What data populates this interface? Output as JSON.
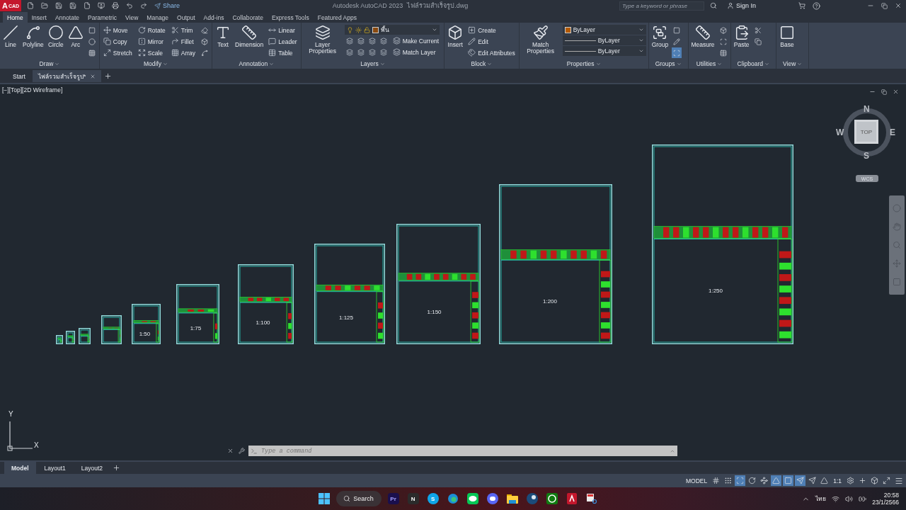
{
  "title_bar": {
    "logo": {
      "letter": "A",
      "sub": "CAD"
    },
    "share": "Share",
    "title": "Autodesk AutoCAD 2023",
    "file": "ไฟล์รวมสำเร็จรูป.dwg",
    "search": {
      "placeholder": "Type a keyword or phrase"
    },
    "sign_in": "Sign In"
  },
  "ribbon_tabs": [
    {
      "label": "Home",
      "selected": true
    },
    {
      "label": "Insert",
      "selected": false
    },
    {
      "label": "Annotate",
      "selected": false
    },
    {
      "label": "Parametric",
      "selected": false
    },
    {
      "label": "View",
      "selected": false
    },
    {
      "label": "Manage",
      "selected": false
    },
    {
      "label": "Output",
      "selected": false
    },
    {
      "label": "Add-ins",
      "selected": false
    },
    {
      "label": "Collaborate",
      "selected": false
    },
    {
      "label": "Express Tools",
      "selected": false
    },
    {
      "label": "Featured Apps",
      "selected": false
    }
  ],
  "panels": {
    "draw": {
      "title": "Draw",
      "large": [
        "Line",
        "Polyline",
        "Circle",
        "Arc"
      ]
    },
    "modify": {
      "title": "Modify",
      "small": [
        "Move",
        "Rotate",
        "Trim",
        "Copy",
        "Mirror",
        "Fillet",
        "Stretch",
        "Scale",
        "Array"
      ]
    },
    "annotation": {
      "title": "Annotation",
      "large": [
        "Text",
        "Dimension"
      ],
      "small": [
        "Linear",
        "Leader",
        "Table"
      ]
    },
    "layers": {
      "title": "Layers",
      "large": [
        "Layer Properties"
      ],
      "layer": "พื้น",
      "small": [
        "Make Current",
        "Match Layer"
      ]
    },
    "block": {
      "title": "Block",
      "large": [
        "Insert"
      ],
      "small": [
        "Create",
        "Edit",
        "Edit Attributes"
      ]
    },
    "properties": {
      "title": "Properties",
      "large": [
        "Match Properties"
      ],
      "dropdowns": [
        {
          "value": "ByLayer",
          "color": "#b35a00"
        },
        {
          "value": "ByLayer"
        },
        {
          "value": "ByLayer"
        }
      ]
    },
    "groups": {
      "title": "Groups",
      "large": [
        "Group"
      ]
    },
    "utilities": {
      "title": "Utilities",
      "large": [
        "Measure"
      ]
    },
    "clipboard": {
      "title": "Clipboard",
      "large": [
        "Paste"
      ]
    },
    "view": {
      "title": "View",
      "large": [
        "Base"
      ]
    }
  },
  "doc_tabs": [
    {
      "label": "Start",
      "selected": false
    },
    {
      "label": "ไฟล์รวมสำเร็จรูป*",
      "selected": true
    }
  ],
  "viewport": {
    "label": "[−][Top][2D Wireframe]"
  },
  "viewcube": {
    "north": "N",
    "south": "S",
    "east": "E",
    "west": "W",
    "face": "TOP",
    "ucs": "WCS"
  },
  "sheets": [
    {
      "kind": "blank"
    },
    {
      "kind": "blank"
    },
    {
      "kind": "blank"
    },
    {
      "kind": "blank"
    },
    {
      "kind": "labeled",
      "label": "1:50"
    },
    {
      "kind": "labeled",
      "label": "1:75"
    },
    {
      "kind": "labeled",
      "label": "1:100"
    },
    {
      "kind": "labeled",
      "label": "1:125"
    },
    {
      "kind": "labeled",
      "label": "1:150"
    },
    {
      "kind": "labeled",
      "label": "1:200"
    },
    {
      "kind": "labeled",
      "label": "1:250"
    }
  ],
  "ucs_icon": {
    "x": "X",
    "y": "Y"
  },
  "command_line": {
    "placeholder": "Type a command"
  },
  "layout_tabs": [
    {
      "label": "Model",
      "selected": true
    },
    {
      "label": "Layout1",
      "selected": false
    },
    {
      "label": "Layout2",
      "selected": false
    }
  ],
  "status_bar": {
    "space": "MODEL",
    "scale": "1:1",
    "toggles": [
      {
        "on": false
      },
      {
        "on": false
      },
      {
        "on": true
      },
      {
        "on": false
      },
      {
        "on": false
      },
      {
        "on": true
      },
      {
        "on": true
      },
      {
        "on": true
      },
      {
        "on": false
      },
      {
        "on": false
      }
    ]
  },
  "taskbar": {
    "search": "Search",
    "language": "ไทย",
    "time": "20:58",
    "date": "23/1/2566",
    "apps": [
      {
        "kind": "premiere",
        "label": "Pr"
      },
      {
        "kind": "notion",
        "label": "N"
      },
      {
        "kind": "skype",
        "label": "S"
      },
      {
        "kind": "edge"
      },
      {
        "kind": "chat"
      },
      {
        "kind": "discord"
      },
      {
        "kind": "folder"
      },
      {
        "kind": "steam"
      },
      {
        "kind": "xbox"
      },
      {
        "kind": "autocad"
      },
      {
        "kind": "snip"
      }
    ]
  }
}
